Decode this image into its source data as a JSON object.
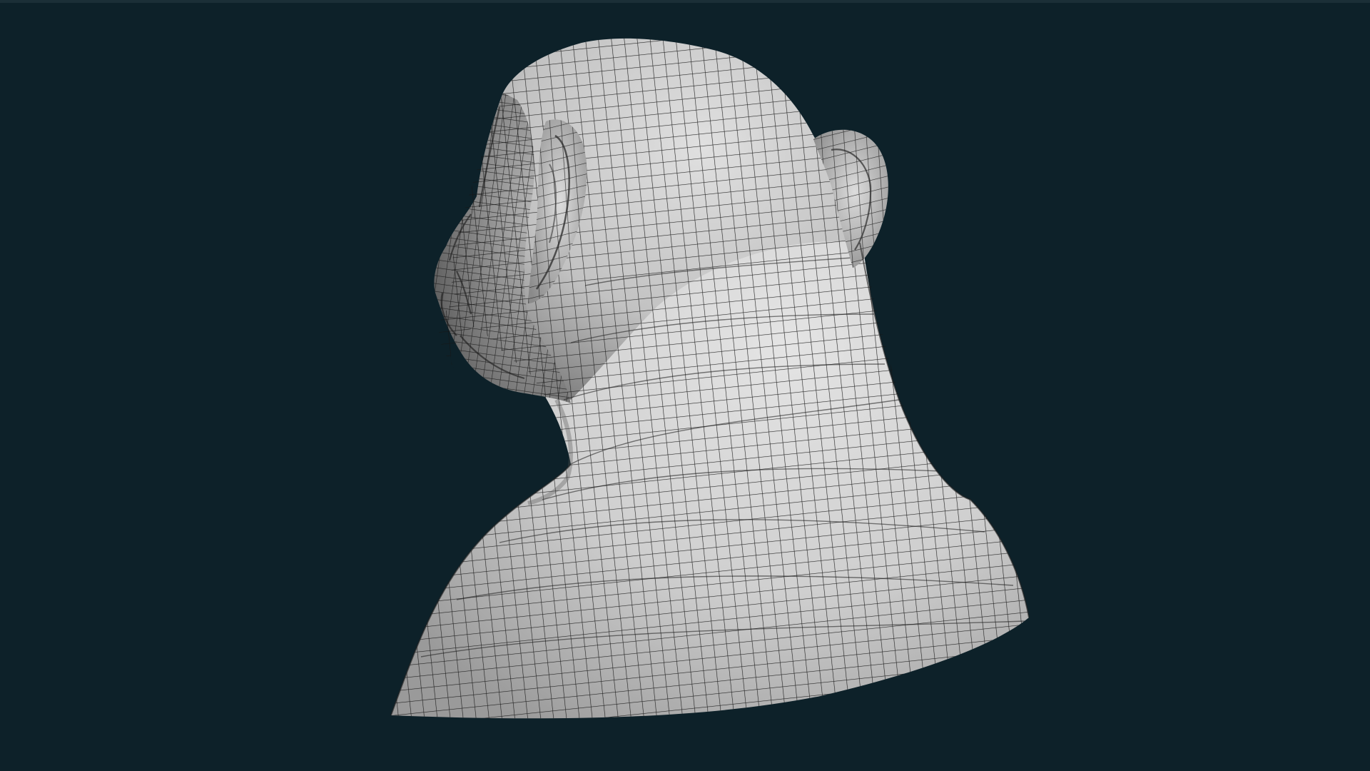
{
  "viewport": {
    "background_color": "#0d2129",
    "frame_color": "#1b2f37"
  },
  "model": {
    "name": "",
    "shading": "wireframe-on-shaded",
    "surface_color": "#c9c9c9",
    "wire_color": "#1a1a1a",
    "subject_icon": "ape-head-bust-icon"
  }
}
